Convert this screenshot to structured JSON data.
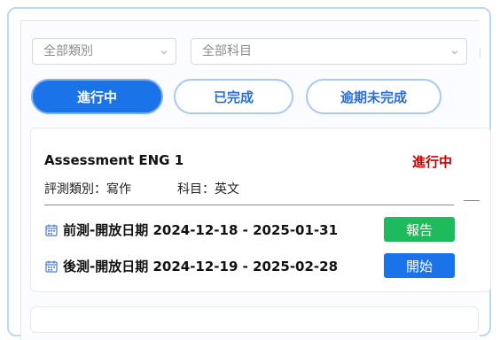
{
  "filters": {
    "category": "全部類別",
    "subject": "全部科目"
  },
  "tabs": [
    {
      "label": "進行中",
      "active": true
    },
    {
      "label": "已完成",
      "active": false
    },
    {
      "label": "逾期未完成",
      "active": false
    }
  ],
  "card": {
    "title": "Assessment ENG 1",
    "status": "進行中",
    "category_label": "評測類別：寫作",
    "subject_label": "科目：英文",
    "rows": [
      {
        "label": "前測-開放日期 2024-12-18 - 2025-01-31",
        "button": "報告",
        "icon": "calendar-icon"
      },
      {
        "label": "後測-開放日期 2024-12-19 - 2025-02-28",
        "button": "開始",
        "icon": "calendar-icon"
      }
    ]
  },
  "colors": {
    "accent": "#1a73e8",
    "status_red": "#c40000",
    "report_green": "#1fba5b"
  }
}
